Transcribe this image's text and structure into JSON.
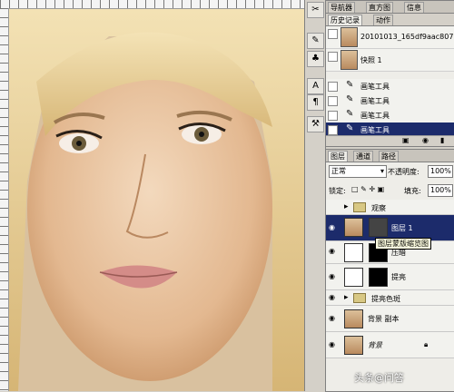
{
  "canvas": {
    "image_alt": "portrait-photo"
  },
  "history_panel": {
    "tabs": [
      "导航器",
      "直方图",
      "信息"
    ],
    "subtabs": [
      "历史记录",
      "动作"
    ],
    "items": [
      {
        "label": "20101013_165df9aac807...",
        "thumb": true
      },
      {
        "label": "快照 1",
        "thumb": true
      },
      {
        "label": "画笔工具",
        "tool": true
      },
      {
        "label": "画笔工具",
        "tool": true
      },
      {
        "label": "画笔工具",
        "tool": true
      },
      {
        "label": "画笔工具",
        "tool": true,
        "selected": true
      }
    ]
  },
  "layers_panel": {
    "tabs": [
      "图层",
      "通道",
      "路径"
    ],
    "blend_mode": "正常",
    "opacity_label": "不透明度:",
    "opacity_value": "100%",
    "lock_label": "锁定:",
    "fill_label": "填充:",
    "fill_value": "100%",
    "layers": [
      {
        "name": "观察",
        "type": "group"
      },
      {
        "name": "图层 1",
        "type": "layer",
        "selected": true
      },
      {
        "name": "压暗",
        "type": "adjustment"
      },
      {
        "name": "提亮",
        "type": "adjustment"
      },
      {
        "name": "提亮色斑",
        "type": "group"
      },
      {
        "name": "背景 副本",
        "type": "layer"
      },
      {
        "name": "背景",
        "type": "layer",
        "locked": true
      }
    ],
    "tooltip": "图层蒙版缩览图"
  },
  "watermark": "头条@问答",
  "colors": {
    "selection": "#1c2b6b",
    "panel_bg": "#eeede8"
  }
}
